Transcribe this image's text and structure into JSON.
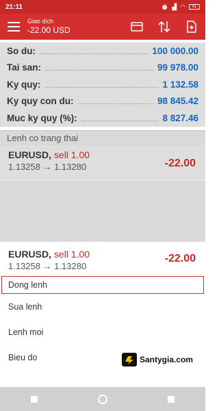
{
  "status_bar": {
    "time": "21:11",
    "battery": "41"
  },
  "app_bar": {
    "title_small": "Giao dich",
    "title_value": "-22.00 USD"
  },
  "summary": [
    {
      "label": "So du:",
      "value": "100 000.00"
    },
    {
      "label": "Tai san:",
      "value": "99 978.00"
    },
    {
      "label": "Ky quy:",
      "value": "1 132.58"
    },
    {
      "label": "Ky quy con du:",
      "value": "98 845.42"
    },
    {
      "label": "Muc ky quy (%):",
      "value": "8 827.46"
    }
  ],
  "section_header": "Lenh co trang thai",
  "position": {
    "symbol": "EURUSD,",
    "side": "sell 1.00",
    "prices": "1.13258 → 1.13280",
    "profit": "-22.00"
  },
  "sheet": {
    "symbol": "EURUSD,",
    "side": "sell 1.00",
    "prices": "1.13258 → 1.13280",
    "profit": "-22.00",
    "items": [
      "Dong lenh",
      "Sua lenh",
      "Lenh moi",
      "Bieu do"
    ]
  },
  "watermark": "Santygia.com",
  "colors": {
    "primary": "#d32f2f",
    "value_blue": "#1565c0",
    "loss_red": "#c62828"
  },
  "icons": [
    "menu-icon",
    "wallet-icon",
    "sort-arrows-icon",
    "new-order-icon",
    "back-icon",
    "home-icon",
    "recents-icon"
  ]
}
